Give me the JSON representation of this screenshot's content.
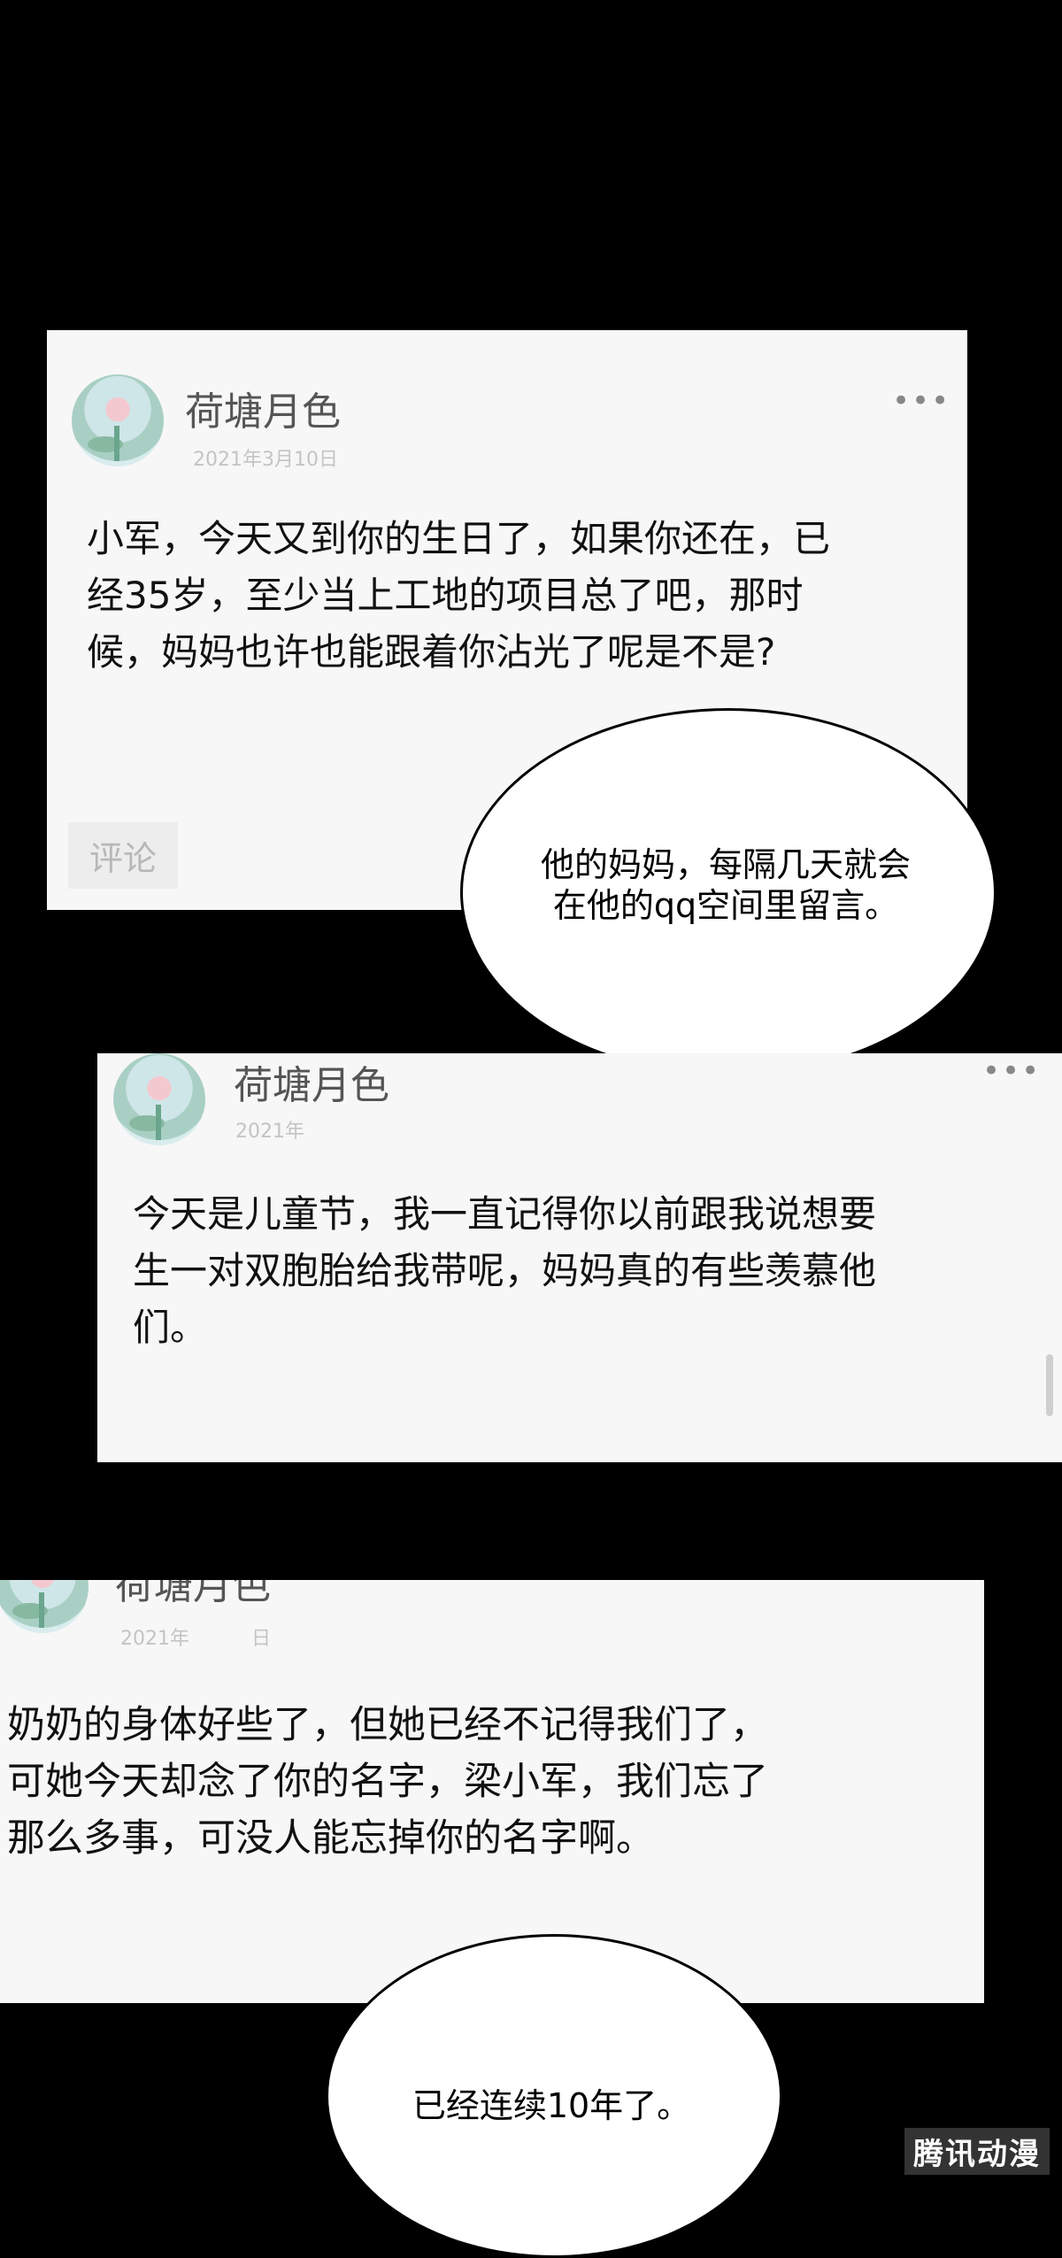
{
  "posts": [
    {
      "name": "荷塘月色",
      "date": "2021年3月10日",
      "menu": "•••",
      "lines": [
        "小军，今天又到你的生日了，如果你还在，已",
        "经35岁，至少当上工地的项目总了吧，那时",
        "候，妈妈也许也能跟着你沾光了呢是不是?"
      ],
      "comment": "评论"
    },
    {
      "name": "荷塘月色",
      "date": "2021年",
      "menu": "•••",
      "lines": [
        "今天是儿童节，我一直记得你以前跟我说想要",
        "生一对双胞胎给我带呢，妈妈真的有些羡慕他",
        "们。"
      ]
    },
    {
      "name": "荷塘月色",
      "date": "2021年",
      "date_end": "日",
      "lines": [
        "奶奶的身体好些了，但她已经不记得我们了，",
        "可她今天却念了你的名字，梁小军，我们忘了",
        "那么多事，可没人能忘掉你的名字啊。"
      ]
    }
  ],
  "bubbles": [
    {
      "lines": [
        "他的妈妈，每隔几天就会",
        "在他的qq空间里留言。"
      ]
    },
    {
      "lines": [
        "已经连续10年了。"
      ]
    }
  ],
  "watermark": "腾讯动漫"
}
